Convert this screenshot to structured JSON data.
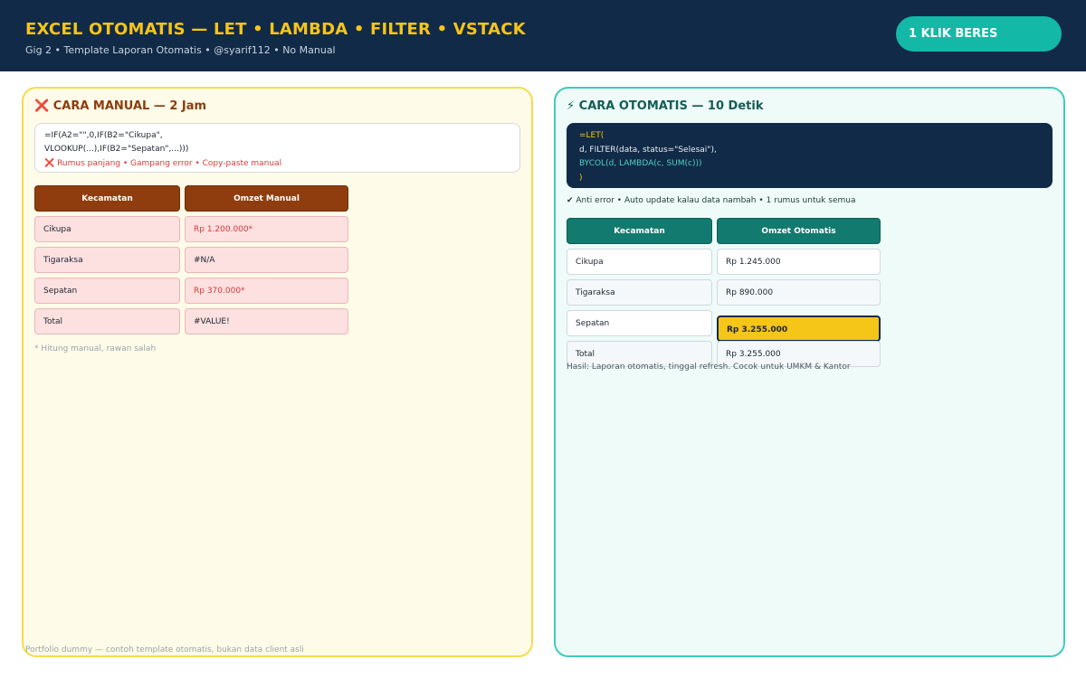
{
  "header": {
    "title": "EXCEL OTOMATIS — LET • LAMBDA • FILTER • VSTACK",
    "subtitle": "Gig 2 • Template Laporan Otomatis  •  @syarif112  •  No Manual",
    "cta": "1 KLIK BERES"
  },
  "manual": {
    "title": "❌ CARA MANUAL — 2 Jam",
    "code": [
      "=IF(A2=\"\",0,IF(B2=\"Cikupa\",",
      "    VLOOKUP(...),IF(B2=\"Sepatan\",...)))"
    ],
    "warning": "❌ Rumus panjang • Gampang error • Copy-paste manual",
    "columns": [
      "Kecamatan",
      "Omzet Manual"
    ],
    "rows": [
      [
        "Cikupa",
        "Rp  1.200.000*"
      ],
      [
        "Tigaraksa",
        "#N/A"
      ],
      [
        "Sepatan",
        "Rp  370.000*"
      ],
      [
        "Total",
        "#VALUE!"
      ]
    ],
    "footnote": "* Hitung manual, rawan salah"
  },
  "auto": {
    "title": "⚡ CARA OTOMATIS — 10 Detik",
    "code": [
      "=LET(",
      "  d, FILTER(data, status=\"Selesai\"),",
      "  BYCOL(d, LAMBDA(c, SUM(c)))",
      ")"
    ],
    "features": "✔ Anti error • Auto update kalau data nambah • 1 rumus untuk semua",
    "columns": [
      "Kecamatan",
      "Omzet Otomatis"
    ],
    "rows": [
      [
        "Cikupa",
        "Rp 1.245.000"
      ],
      [
        "Tigaraksa",
        "Rp 890.000"
      ],
      [
        "Sepatan",
        "Rp 3.255.000"
      ],
      [
        "Total",
        "Rp 3.255.000"
      ]
    ],
    "result": "Hasil: Laporan otomatis, tinggal refresh. Cocok untuk UMKM & Kantor"
  },
  "footer": "Portfolio dummy — contoh template otomatis, bukan data client asli",
  "colors": {
    "header_bg": "#112a47",
    "accent_yellow": "#f5c518",
    "accent_teal": "#14b8a6",
    "manual_header": "#8f3d0e",
    "auto_header": "#127a6e",
    "error_red": "#d63b3b"
  }
}
